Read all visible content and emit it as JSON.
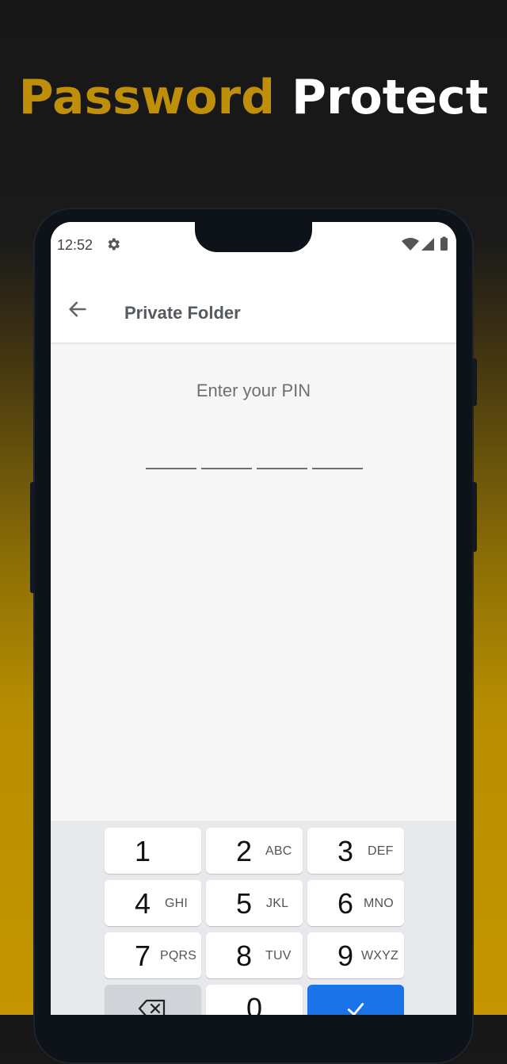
{
  "headline": {
    "word1": "Password",
    "word2": "Protect"
  },
  "status": {
    "time": "12:52"
  },
  "appbar": {
    "title": "Private Folder"
  },
  "pin": {
    "prompt": "Enter your PIN",
    "digits_entered": 0
  },
  "keypad": {
    "keys": [
      {
        "num": "1",
        "letters": ""
      },
      {
        "num": "2",
        "letters": "ABC"
      },
      {
        "num": "3",
        "letters": "DEF"
      },
      {
        "num": "4",
        "letters": "GHI"
      },
      {
        "num": "5",
        "letters": "JKL"
      },
      {
        "num": "6",
        "letters": "MNO"
      },
      {
        "num": "7",
        "letters": "PQRS"
      },
      {
        "num": "8",
        "letters": "TUV"
      },
      {
        "num": "9",
        "letters": "WXYZ"
      },
      {
        "num": "0",
        "letters": ""
      }
    ],
    "backspace_icon": "backspace-icon",
    "confirm_icon": "checkmark-icon"
  },
  "colors": {
    "headline_accent": "#c08f0a",
    "headline_white": "#ffffff",
    "confirm_key": "#1a73e8"
  }
}
